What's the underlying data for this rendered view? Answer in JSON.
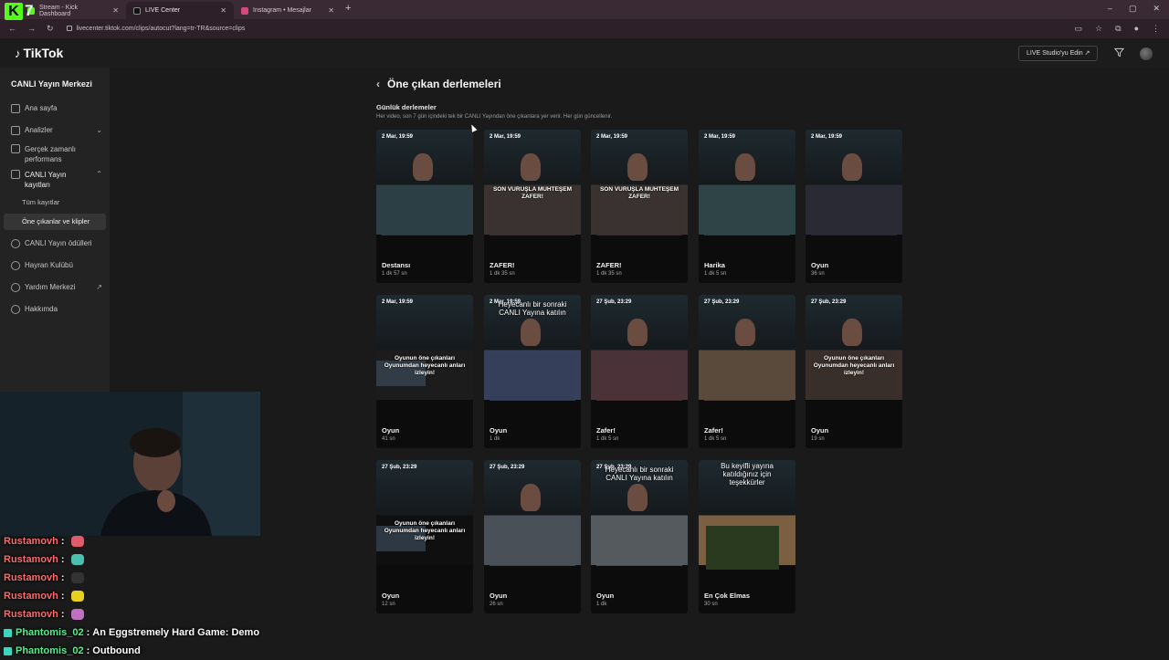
{
  "browser": {
    "tabs": [
      {
        "label": "Kick Dashboard",
        "prefix": "Stream - "
      },
      {
        "label": "LIVE Center"
      },
      {
        "label": "Instagram • Mesajlar"
      }
    ],
    "url": "livecenter.tiktok.com/clips/autocut?lang=tr-TR&source=clips"
  },
  "overlay_logo": {
    "letter": "K",
    "number": "7"
  },
  "header": {
    "logo": "TikTok",
    "studio_button": "LIVE Studio'yu Edin ↗"
  },
  "sidebar": {
    "title": "CANLI Yayın Merkezi",
    "items": [
      {
        "label": "Ana sayfa",
        "icon": "home-icon"
      },
      {
        "label": "Analizler",
        "icon": "chart-icon"
      },
      {
        "label": "Gerçek zamanlı performans",
        "icon": "monitor-icon"
      },
      {
        "label": "CANLI Yayın kayıtları",
        "icon": "recordings-icon"
      },
      {
        "label": "CANLI Yayın ödülleri",
        "icon": "award-icon"
      },
      {
        "label": "Hayran Kulübü",
        "icon": "heart-icon"
      },
      {
        "label": "Yardım Merkezi",
        "icon": "help-icon"
      },
      {
        "label": "Hakkımda",
        "icon": "user-icon"
      }
    ],
    "subitems": [
      {
        "label": "Tüm kayıtlar"
      },
      {
        "label": "Öne çıkanlar ve klipler"
      }
    ]
  },
  "main": {
    "title": "Öne çıkan derlemeleri",
    "section_title": "Günlük derlemeler",
    "section_desc": "Her video, son 7 gün içindeki tek bir CANLI Yayından öne çıkanlara yer verir. Her gün güncellenir."
  },
  "clips": [
    {
      "date": "2 Mar, 19:59",
      "title": "Destansı",
      "duration": "1 dk 57 sn",
      "overlay": "",
      "big": ""
    },
    {
      "date": "2 Mar, 19:59",
      "title": "ZAFER!",
      "duration": "1 dk 35 sn",
      "overlay": "SON VURUŞLA MUHTEŞEM ZAFER!",
      "big": ""
    },
    {
      "date": "2 Mar, 19:59",
      "title": "ZAFER!",
      "duration": "1 dk 35 sn",
      "overlay": "SON VURUŞLA MUHTEŞEM ZAFER!",
      "big": ""
    },
    {
      "date": "2 Mar, 19:59",
      "title": "Harika",
      "duration": "1 dk 5 sn",
      "overlay": "",
      "big": ""
    },
    {
      "date": "2 Mar, 19:59",
      "title": "Oyun",
      "duration": "36 sn",
      "overlay": "",
      "big": ""
    },
    {
      "date": "2 Mar, 19:59",
      "title": "Oyun",
      "duration": "41 sn",
      "overlay": "Oyunun öne çıkanları Oyunumdan heyecanlı anları izleyin!",
      "big": ""
    },
    {
      "date": "2 Mar, 19:59",
      "title": "Oyun",
      "duration": "1 dk",
      "overlay": "",
      "big": "Heyecanlı bir sonraki CANLI Yayına katılın"
    },
    {
      "date": "27 Şub, 23:29",
      "title": "Zafer!",
      "duration": "1 dk 5 sn",
      "overlay": "",
      "big": ""
    },
    {
      "date": "27 Şub, 23:29",
      "title": "Zafer!",
      "duration": "1 dk 5 sn",
      "overlay": "",
      "big": ""
    },
    {
      "date": "27 Şub, 23:29",
      "title": "Oyun",
      "duration": "19 sn",
      "overlay": "Oyunun öne çıkanları Oyunumdan heyecanlı anları izleyin!",
      "big": ""
    },
    {
      "date": "27 Şub, 23:29",
      "title": "Oyun",
      "duration": "12 sn",
      "overlay": "Oyunun öne çıkanları Oyunumdan heyecanlı anları izleyin!",
      "big": ""
    },
    {
      "date": "27 Şub, 23:29",
      "title": "Oyun",
      "duration": "26 sn",
      "overlay": "",
      "big": ""
    },
    {
      "date": "27 Şub, 23:29",
      "title": "Oyun",
      "duration": "1 dk",
      "overlay": "",
      "big": "Heyecanlı bir sonraki CANLI Yayına katılın"
    },
    {
      "date": "",
      "title": "En Çok Elmas",
      "duration": "30 sn",
      "overlay": "",
      "big": "Bu keyifli yayına katıldığınız için teşekkürler"
    }
  ],
  "chat": [
    {
      "user": "Rustamovh",
      "sep": ":",
      "message": "",
      "emote_color": "#e05a6a"
    },
    {
      "user": "Rustamovh",
      "sep": ":",
      "message": "",
      "emote_color": "#4cc0b0"
    },
    {
      "user": "Rustamovh",
      "sep": ":",
      "message": "",
      "emote_color": "#333333"
    },
    {
      "user": "Rustamovh",
      "sep": ":",
      "message": "",
      "emote_color": "#e8d020"
    },
    {
      "user": "Rustamovh",
      "sep": ":",
      "message": "",
      "emote_color": "#c070c0"
    },
    {
      "user": "Phantomis_02",
      "sep": ":",
      "message": "An Eggstremely Hard Game: Demo"
    },
    {
      "user": "Phantomis_02",
      "sep": ":",
      "message": "Outbound"
    }
  ],
  "colors": {
    "accent_kick": "#53fc18",
    "chat_user": "#ff6a6a",
    "chat_user_alt": "#54f08a"
  }
}
